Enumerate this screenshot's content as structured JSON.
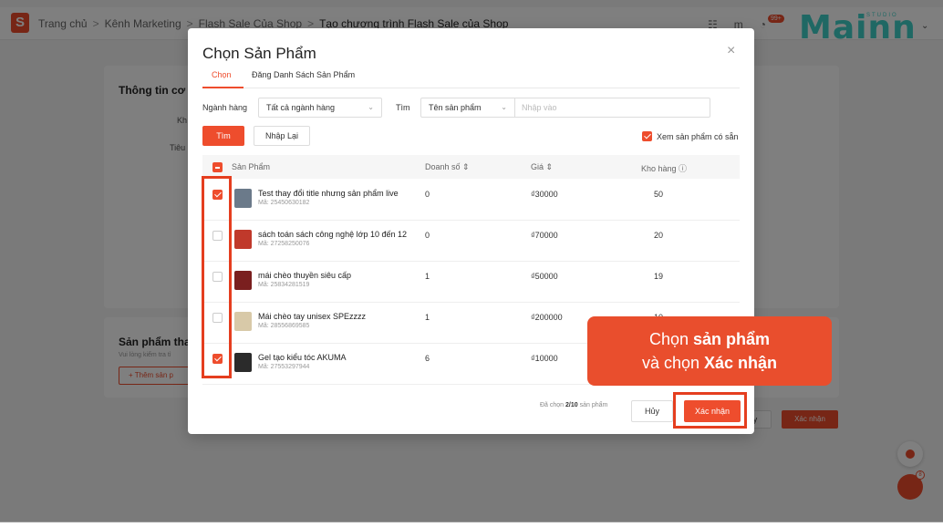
{
  "breadcrumb": {
    "logo": "S",
    "items": [
      "Trang chủ",
      "Kênh Marketing",
      "Flash Sale Của Shop",
      "Tạo chương trình Flash Sale của Shop"
    ],
    "separator": ">"
  },
  "topbar": {
    "apps_icon": "grid-icon",
    "notif_badge": "99+",
    "user_initial": "m"
  },
  "brand": {
    "name": "Mainn",
    "tagline": "STUDIO"
  },
  "background": {
    "info_title": "Thông tin cơ b",
    "info_label1": "Kh",
    "info_label2": "Tiêu",
    "products_title": "Sản phẩm thai",
    "products_subtitle": "Vui lòng kiểm tra tì",
    "add_button": "+ Thêm sản p",
    "cancel_button": "y",
    "confirm_button": "Xác nhận",
    "chat_badge": "8"
  },
  "modal": {
    "title": "Chọn Sản Phẩm",
    "close": "×",
    "tabs": [
      {
        "label": "Chọn",
        "active": true
      },
      {
        "label": "Đăng Danh Sách Sản Phẩm",
        "active": false
      }
    ],
    "filters": {
      "category_label": "Ngành hàng",
      "category_value": "Tất cả ngành hàng",
      "search_label": "Tìm",
      "search_type_value": "Tên sản phẩm",
      "search_placeholder": "Nhập vào"
    },
    "buttons": {
      "search": "Tìm",
      "reset": "Nhập Lại"
    },
    "show_available": {
      "label": "Xem sản phẩm có sẵn",
      "checked": true
    },
    "table": {
      "headers": [
        "Sản Phẩm",
        "Doanh số ⇕",
        "Giá ⇕",
        "Kho hàng ⓘ"
      ],
      "rows": [
        {
          "name": "Test thay đổi title nhưng sản phẩm live",
          "code": "Mã: 25450630182",
          "sales": "0",
          "price": "₫30000",
          "stock": "50",
          "checked": true,
          "thumb_color": "#6b7a8a"
        },
        {
          "name": "sách toán sách công nghệ lớp 10 đến 12",
          "code": "Mã: 27258250076",
          "sales": "0",
          "price": "₫70000",
          "stock": "20",
          "checked": false,
          "thumb_color": "#c0392b"
        },
        {
          "name": "mái chèo thuyền siêu cấp",
          "code": "Mã: 25834281519",
          "sales": "1",
          "price": "₫50000",
          "stock": "19",
          "checked": false,
          "thumb_color": "#7a1f1f"
        },
        {
          "name": "Mái chèo tay unisex SPEzzzz",
          "code": "Mã: 28556869585",
          "sales": "1",
          "price": "₫200000",
          "stock": "10",
          "checked": false,
          "thumb_color": "#d8c9a8"
        },
        {
          "name": "Gel tạo kiểu tóc AKUMA",
          "code": "Mã: 27553297944",
          "sales": "6",
          "price": "₫10000",
          "stock": "",
          "checked": true,
          "thumb_color": "#2b2b2b"
        }
      ]
    },
    "footer": {
      "selected_prefix": "Đã chọn",
      "selected_count": "2/10",
      "selected_suffix": "sản phẩm",
      "cancel": "Hủy",
      "confirm": "Xác nhận"
    }
  },
  "callout": {
    "line1_prefix": "Chọn ",
    "line1_bold": "sản phẩm",
    "line2_prefix": "và chọn ",
    "line2_bold": "Xác nhận"
  },
  "colors": {
    "accent": "#ee4d2d",
    "callout": "#e94e2d",
    "brand": "#3fd1c8"
  }
}
